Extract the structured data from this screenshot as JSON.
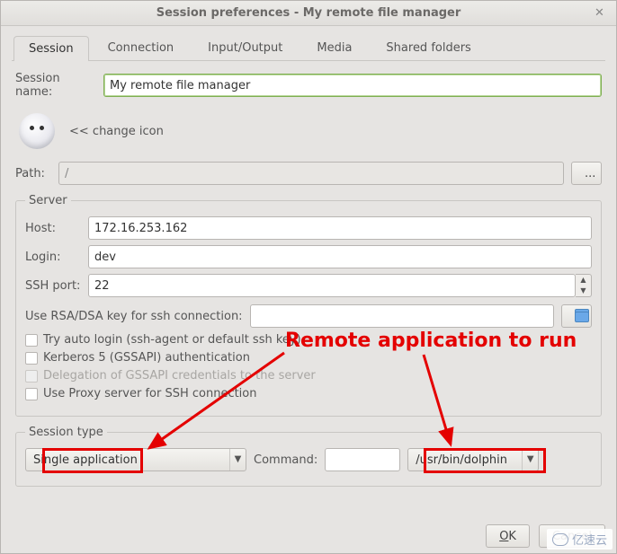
{
  "window": {
    "title": "Session preferences - My remote file manager"
  },
  "tabs": [
    {
      "label": "Session"
    },
    {
      "label": "Connection"
    },
    {
      "label": "Input/Output"
    },
    {
      "label": "Media"
    },
    {
      "label": "Shared folders"
    }
  ],
  "session_name": {
    "label": "Session name:",
    "value": "My remote file manager"
  },
  "change_icon": {
    "label": "<< change icon"
  },
  "path": {
    "label": "Path:",
    "value": "/",
    "browse": "..."
  },
  "server": {
    "legend": "Server",
    "host_label": "Host:",
    "host": "172.16.253.162",
    "login_label": "Login:",
    "login": "dev",
    "port_label": "SSH port:",
    "port": "22",
    "key_label": "Use RSA/DSA key for ssh connection:",
    "key_value": "",
    "opts": [
      {
        "text": "Try auto login (ssh-agent or default ssh key)",
        "disabled": false
      },
      {
        "text": "Kerberos 5 (GSSAPI) authentication",
        "disabled": false
      },
      {
        "text": "Delegation of GSSAPI credentials to the server",
        "disabled": true
      },
      {
        "text": "Use Proxy server for SSH connection",
        "disabled": false
      }
    ]
  },
  "session_type": {
    "legend": "Session type",
    "app": "Single application",
    "command_label": "Command:",
    "command": "",
    "path": "/usr/bin/dolphin"
  },
  "footer": {
    "ok": "OK",
    "cancel": "Cancel"
  },
  "annotation": {
    "text": "Remote application to run"
  },
  "watermark": {
    "text": "亿速云"
  }
}
